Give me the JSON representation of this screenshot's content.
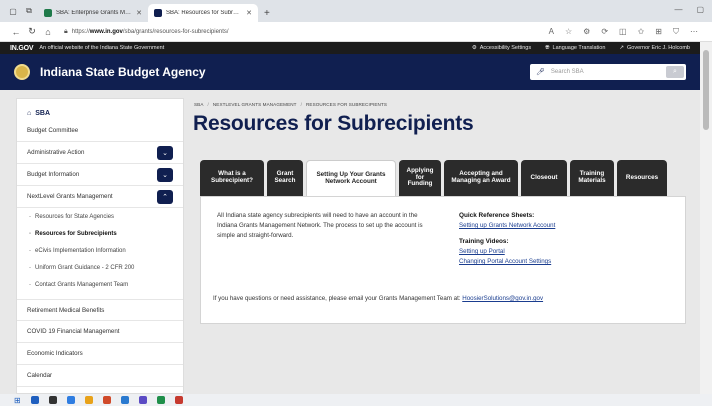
{
  "browser": {
    "tabs": [
      {
        "title": "SBA: Enterprise Grants Manageme",
        "active": false,
        "favicon_color": "#1f7a4a"
      },
      {
        "title": "SBA: Resources for Subrecipients",
        "active": true,
        "favicon_color": "#101f50"
      }
    ],
    "new_tab": "+",
    "url_prefix": "https://",
    "url_host": "www.in.gov",
    "url_path": "/sba/grants/resources-for-subrecipients/"
  },
  "gov_bar": {
    "logo": "IN.GOV",
    "official_text": "An official website of the Indiana State Government",
    "links": [
      "Accessibility Settings",
      "Language Translation",
      "Governor Eric J. Holcomb"
    ]
  },
  "header": {
    "agency": "Indiana State Budget Agency",
    "search_placeholder": "Search SBA"
  },
  "sidebar": {
    "home": "SBA",
    "items": [
      {
        "label": "Budget Committee",
        "chevron": ""
      },
      {
        "label": "Administrative Action",
        "chevron": "v"
      },
      {
        "label": "Budget Information",
        "chevron": "v"
      },
      {
        "label": "NextLevel Grants Management",
        "chevron": "^"
      }
    ],
    "sub_items": [
      {
        "label": "Resources for State Agencies",
        "active": false
      },
      {
        "label": "Resources for Subrecipients",
        "active": true
      },
      {
        "label": "eCivis Implementation Information",
        "active": false
      },
      {
        "label": "Uniform Grant Guidance - 2 CFR 200",
        "active": false
      },
      {
        "label": "Contact Grants Management Team",
        "active": false
      }
    ],
    "items_after": [
      {
        "label": "Retirement Medical Benefits"
      },
      {
        "label": "COVID 19 Financial Management"
      },
      {
        "label": "Economic Indicators"
      },
      {
        "label": "Calendar"
      }
    ]
  },
  "breadcrumb": [
    "SBA",
    "NextLevel Grants Management",
    "Resources for Subrecipients"
  ],
  "page_title": "Resources for Subrecipients",
  "tabs": [
    {
      "label": "What is a Subrecipient?",
      "active": false,
      "w": 64
    },
    {
      "label": "Grant Search",
      "active": false,
      "w": 36
    },
    {
      "label": "Setting Up Your Grants Network Account",
      "active": true,
      "w": 90
    },
    {
      "label": "Applying for Funding",
      "active": false,
      "w": 42
    },
    {
      "label": "Accepting and Managing an Award",
      "active": false,
      "w": 74
    },
    {
      "label": "Closeout",
      "active": false,
      "w": 46
    },
    {
      "label": "Training Materials",
      "active": false,
      "w": 44
    },
    {
      "label": "Resources",
      "active": false,
      "w": 50
    }
  ],
  "panel": {
    "intro": "All Indiana state agency subrecipients will need to have an account in the Indiana Grants Management Network.  The process to set up the account is simple and straight-forward.",
    "quick_ref_heading": "Quick Reference Sheets:",
    "quick_ref_links": [
      "Setting up Grants Network Account"
    ],
    "training_heading": "Training Videos:",
    "training_links": [
      "Setting up Portal",
      "Changing Portal Account Settings"
    ],
    "help_text": "If you have questions or need assistance, please email your Grants Management Team at: ",
    "help_email": "HoosierSolutions@gov.in.gov"
  },
  "taskbar": {
    "icons": [
      "#1f5fbf",
      "#333333",
      "#2f7de1",
      "#e8a21a",
      "#d04a2a",
      "#2a7ad0",
      "#5b4bc4",
      "#1f8f4a",
      "#c63a2f"
    ]
  }
}
